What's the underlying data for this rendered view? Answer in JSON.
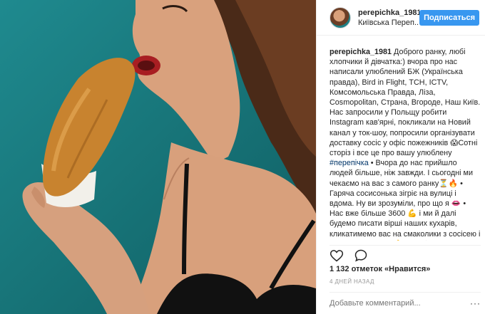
{
  "post": {
    "image_alt_icon": "photo",
    "header": {
      "username": "perepichka_1981",
      "location": "Київська Переп...",
      "follow_label": "Подписаться"
    },
    "caption": {
      "username": "perepichka_1981",
      "text_1": " Доброго ранку, любі хлопчики й дівчатка:) вчора про нас написали улюблений БЖ (Українська правда), Bird in Flight, ТСН, ICTV, Комсомольська Правда, Ліза, Cosmopolitan, Страна, Вгороде, Наш Київ. Нас запросили у Польщу робити Instagram кав'ярні, покликали на Новий канал у ток-шоу, попросили організувати доставку сосіс у офіс пожежників 😱Сотні сторіз і все це про вашу улюблену ",
      "hashtag": "#перепічка",
      "text_2": " • Вчора до нас прийшло людей більше, ніж завжди. І сьогодні ми чекаємо на вас з самого ранку⏳🔥 • Гаряча сосисонька зігріє на вулиці і вдома. Ну ви зрозуміли, про що я 👄 • Нас вже більше 3600 💪 і ми й далі будемо писати вірші наших кухарів, кликатимемо вас на смаколики з сосісею і це тільки початок 👌 далі буде гарячіше 🔥🔥 набагато гарячіше ⏳🔥 мой про"
    },
    "actions": {
      "like_icon": "heart-icon",
      "comment_icon": "comment-icon"
    },
    "likes_text": "1 132 отметок «Нравится»",
    "date_text": "4 ДНЕЙ НАЗАД",
    "comment_placeholder": "Добавьте комментарий...",
    "more_label": "···",
    "colors": {
      "follow_button": "#3897f0",
      "photo_background": "#1d8388",
      "hashtag": "#003569",
      "muted": "#999999"
    }
  }
}
